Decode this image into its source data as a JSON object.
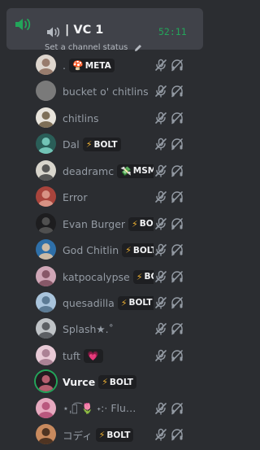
{
  "channel": {
    "name": "| VC 1",
    "timer": "52:11",
    "status_placeholder": "Set a channel status"
  },
  "colors": {
    "background": "#2b2d31",
    "channel_highlight": "#404249",
    "speaking_green": "#23a55a",
    "muted_text": "#949ba4",
    "bright_text": "#f2f3f5"
  },
  "members": [
    {
      "name": ".",
      "tag": "META",
      "tag_icon": "mushroom-icon",
      "muted": true,
      "deafened": true,
      "avatar": {
        "bg": "#ded6ce",
        "fg": "#8c6c5c"
      }
    },
    {
      "name": "bucket o' chitlins",
      "tag": "",
      "muted": true,
      "deafened": true,
      "avatar": {
        "bg": "#7a7a7a",
        "fg": "#7a7a7a"
      }
    },
    {
      "name": "chitlins",
      "tag": "",
      "muted": true,
      "deafened": true,
      "avatar": {
        "bg": "#e8e4dc",
        "fg": "#6b5a40"
      }
    },
    {
      "name": "Dal",
      "tag": "BOLT",
      "tag_icon": "bolt-icon",
      "muted": true,
      "deafened": true,
      "avatar": {
        "bg": "#2a5e58",
        "fg": "#7fd6c7"
      }
    },
    {
      "name": "deadramc",
      "tag": "MSMP",
      "tag_icon": "money-icon",
      "muted": true,
      "deafened": true,
      "avatar": {
        "bg": "#d8d5cc",
        "fg": "#3f3f3f"
      }
    },
    {
      "name": "Error",
      "tag": "",
      "muted": true,
      "deafened": true,
      "avatar": {
        "bg": "#a8443c",
        "fg": "#e0a090"
      }
    },
    {
      "name": "Evan Burger",
      "tag": "BOLT",
      "tag_icon": "bolt-icon",
      "muted": true,
      "deafened": true,
      "avatar": {
        "bg": "#1d1d1f",
        "fg": "#595959"
      }
    },
    {
      "name": "God Chitlin",
      "tag": "BOLT",
      "tag_icon": "bolt-icon",
      "muted": true,
      "deafened": true,
      "avatar": {
        "bg": "#2e6fa8",
        "fg": "#e7c9a6"
      }
    },
    {
      "name": "katpocalypse",
      "tag": "BOLT",
      "tag_icon": "bolt-icon",
      "muted": true,
      "deafened": true,
      "avatar": {
        "bg": "#cfa6b6",
        "fg": "#7a4a5a"
      }
    },
    {
      "name": "quesadilla",
      "tag": "BOLT",
      "tag_icon": "bolt-icon",
      "muted": true,
      "deafened": true,
      "avatar": {
        "bg": "#a9c4dc",
        "fg": "#4f6e88"
      }
    },
    {
      "name": "Splash★.˚",
      "tag": "",
      "muted": true,
      "deafened": true,
      "avatar": {
        "bg": "#bfc3c7",
        "fg": "#4a4e52"
      }
    },
    {
      "name": "tuft",
      "tag": "",
      "tag_icon": "heart-icon",
      "muted": true,
      "deafened": true,
      "avatar": {
        "bg": "#e8cad6",
        "fg": "#a0768a"
      }
    },
    {
      "name": "Vurce",
      "tag": "BOLT",
      "tag_icon": "bolt-icon",
      "speaking": true,
      "muted": false,
      "deafened": false,
      "avatar": {
        "bg": "#241a20",
        "fg": "#d06b7e"
      }
    },
    {
      "name": "⋆.ฺ๚͡ 🌷 ˖:· Flu…",
      "tag": "",
      "muted": true,
      "deafened": true,
      "avatar": {
        "bg": "#e6a9bf",
        "fg": "#b04a72"
      }
    },
    {
      "name": "コディ",
      "tag": "BOLT",
      "tag_icon": "bolt-icon",
      "muted": true,
      "deafened": true,
      "avatar": {
        "bg": "#c88a5e",
        "fg": "#3a2418"
      }
    }
  ]
}
